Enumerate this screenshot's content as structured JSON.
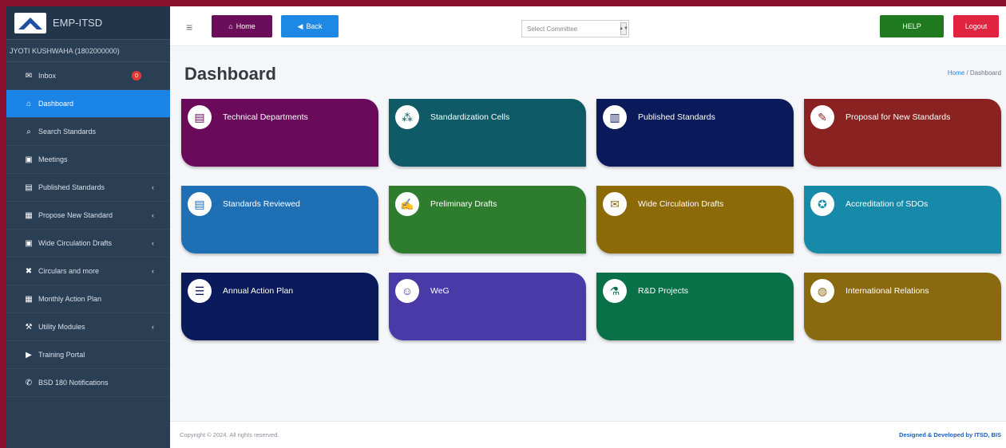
{
  "brand": {
    "title": "EMP-ITSD"
  },
  "user": {
    "name": "JYOTI KUSHWAHA (1802000000)"
  },
  "sidebar": {
    "items": [
      {
        "label": "Inbox",
        "icon": "inbox-icon",
        "glyph": "✉",
        "badge": "0"
      },
      {
        "label": "Dashboard",
        "icon": "dashboard-icon",
        "glyph": "⌂",
        "active": true
      },
      {
        "label": "Search Standards",
        "icon": "search-icon",
        "glyph": "⌕"
      },
      {
        "label": "Meetings",
        "icon": "meetings-icon",
        "glyph": "▣"
      },
      {
        "label": "Published Standards",
        "icon": "book-icon",
        "glyph": "▤",
        "chevron": "‹"
      },
      {
        "label": "Propose New Standard",
        "icon": "file-icon",
        "glyph": "▦",
        "chevron": "‹"
      },
      {
        "label": "Wide Circulation Drafts",
        "icon": "drafts-icon",
        "glyph": "▣",
        "chevron": "‹"
      },
      {
        "label": "Circulars and more",
        "icon": "close-icon",
        "glyph": "✖",
        "chevron": "‹"
      },
      {
        "label": "Monthly Action Plan",
        "icon": "calendar-icon",
        "glyph": "▦"
      },
      {
        "label": "Utility Modules",
        "icon": "utility-icon",
        "glyph": "⚒",
        "chevron": "‹"
      },
      {
        "label": "Training Portal",
        "icon": "video-icon",
        "glyph": "▶"
      },
      {
        "label": "BSD 180 Notifications",
        "icon": "megaphone-icon",
        "glyph": "✆"
      }
    ]
  },
  "topbar": {
    "menu_glyph": "≡",
    "home_label": "Home",
    "home_glyph": "⌂",
    "back_label": "Back",
    "back_glyph": "◀",
    "select_placeholder": "Select Committee",
    "select_caret": "▲▼",
    "help_label": "HELP",
    "logout_label": "Logout"
  },
  "page": {
    "title": "Dashboard",
    "breadcrumb_home": "Home",
    "breadcrumb_sep": " / ",
    "breadcrumb_current": "Dashboard"
  },
  "tiles": [
    {
      "label": "Technical Departments",
      "color": "#6b0a5a",
      "icon": "departments-icon",
      "glyph": "▤"
    },
    {
      "label": "Standardization Cells",
      "color": "#0e5a66",
      "icon": "network-icon",
      "glyph": "⁂"
    },
    {
      "label": "Published Standards",
      "color": "#0a1a5a",
      "icon": "building-icon",
      "glyph": "▥"
    },
    {
      "label": "Proposal for New Standards",
      "color": "#8a2222",
      "icon": "proposal-icon",
      "glyph": "✎"
    },
    {
      "label": "Standards Reviewed",
      "color": "#1f6fb5",
      "icon": "review-icon",
      "glyph": "▤"
    },
    {
      "label": "Preliminary Drafts",
      "color": "#2e7d2e",
      "icon": "draft-icon",
      "glyph": "✍"
    },
    {
      "label": "Wide Circulation Drafts",
      "color": "#8c6a08",
      "icon": "circulation-icon",
      "glyph": "✉"
    },
    {
      "label": "Accreditation of SDOs",
      "color": "#168aa8",
      "icon": "award-icon",
      "glyph": "✪"
    },
    {
      "label": "Annual Action Plan",
      "color": "#0a1a5a",
      "icon": "plan-icon",
      "glyph": "☰"
    },
    {
      "label": "WeG",
      "color": "#4a3aa8",
      "icon": "group-icon",
      "glyph": "☺"
    },
    {
      "label": "R&D Projects",
      "color": "#0a7048",
      "icon": "research-icon",
      "glyph": "⚗"
    },
    {
      "label": "International Relations",
      "color": "#8a6a10",
      "icon": "globe-icon",
      "glyph": "◍"
    }
  ],
  "footer": {
    "copyright": "Copyright © 2024. All rights reserved.",
    "credit": "Designed & Developed by ITSD, BIS"
  }
}
